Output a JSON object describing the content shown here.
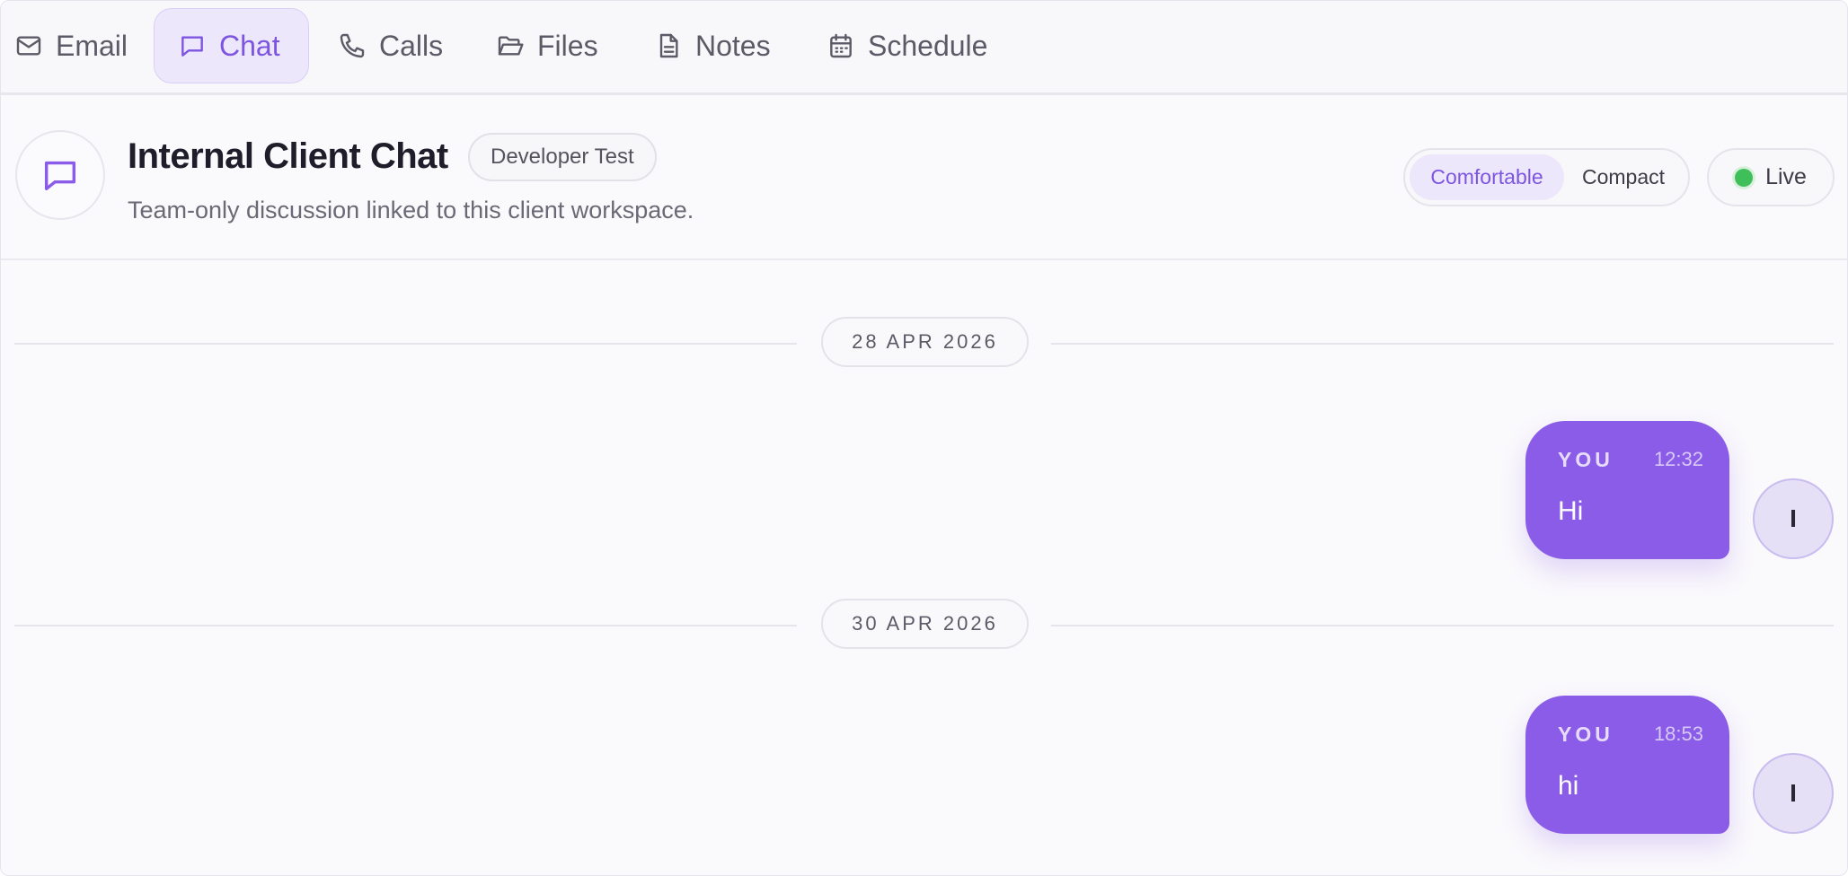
{
  "tabs": [
    {
      "label": "Email",
      "icon": "mail-icon"
    },
    {
      "label": "Chat",
      "icon": "chat-icon",
      "active": true
    },
    {
      "label": "Calls",
      "icon": "phone-icon"
    },
    {
      "label": "Files",
      "icon": "folder-open-icon"
    },
    {
      "label": "Notes",
      "icon": "file-text-icon"
    },
    {
      "label": "Schedule",
      "icon": "calendar-icon"
    }
  ],
  "header": {
    "title": "Internal Client Chat",
    "tag": "Developer Test",
    "subtitle": "Team-only discussion linked to this client workspace.",
    "density": {
      "options": [
        "Comfortable",
        "Compact"
      ],
      "selected": "Comfortable"
    },
    "status": {
      "label": "Live",
      "color": "#3fbf5a"
    }
  },
  "messages": {
    "groups": [
      {
        "date": "28 APR 2026",
        "items": [
          {
            "sender": "YOU",
            "time": "12:32",
            "text": "Hi",
            "avatar_initial": "I"
          }
        ]
      },
      {
        "date": "30 APR 2026",
        "items": [
          {
            "sender": "YOU",
            "time": "18:53",
            "text": "hi",
            "avatar_initial": "I"
          }
        ]
      }
    ]
  },
  "colors": {
    "accent": "#8a5ce8",
    "accent_text": "#7d55e0",
    "accent_soft": "#ece7fb",
    "live": "#3fbf5a"
  }
}
